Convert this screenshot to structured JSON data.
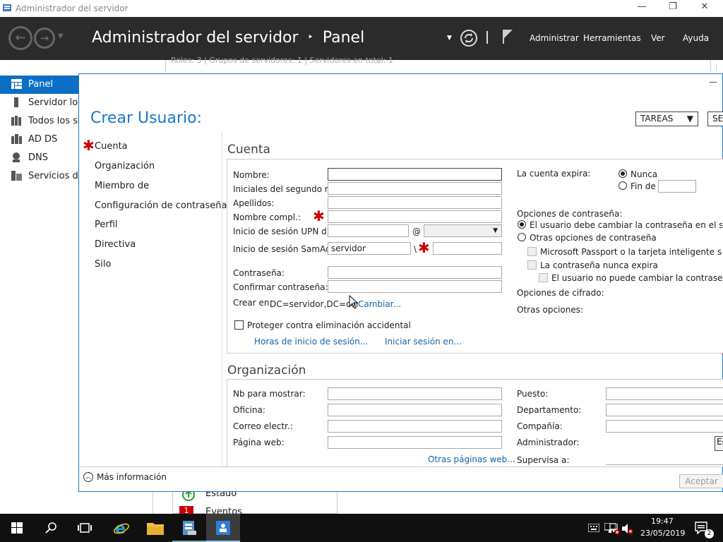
{
  "window": {
    "title": "Administrador del servidor"
  },
  "header": {
    "breadcrumb_root": "Administrador del servidor",
    "breadcrumb_sep": "‣",
    "breadcrumb_page": "Panel",
    "menu": [
      "Administrar",
      "Herramientas",
      "Ver",
      "Ayuda"
    ]
  },
  "sidebar": {
    "items": [
      {
        "label": "Panel",
        "icon": "dashboard-icon"
      },
      {
        "label": "Servidor local",
        "icon": "server-icon"
      },
      {
        "label": "Todos los servidores",
        "icon": "servers-icon"
      },
      {
        "label": "AD DS",
        "icon": "ad-ds-icon"
      },
      {
        "label": "DNS",
        "icon": "dns-icon"
      },
      {
        "label": "Servicios de archivos y de almacenamiento",
        "icon": "storage-icon"
      }
    ]
  },
  "background": {
    "strip": "Roles: 3  |  Grupos de servidores: 1  |  Servidores en total: 1",
    "status_label": "Estado",
    "events_label": "Eventos",
    "events_count": "1"
  },
  "dialog": {
    "title": "Crear Usuario:",
    "tasks_button": "TAREAS",
    "sections_button": "SECCIONES",
    "nav": [
      "Cuenta",
      "Organización",
      "Miembro de",
      "Configuración de contraseña",
      "Perfil",
      "Directiva",
      "Silo"
    ],
    "more_info": "Más información",
    "accept_button": "Aceptar"
  },
  "account": {
    "heading": "Cuenta",
    "first_name_label": "Nombre:",
    "initials_label": "Iniciales del segundo n...",
    "last_name_label": "Apellidos:",
    "full_name_label": "Nombre compl.:",
    "upn_label": "Inicio de sesión UPN d...",
    "upn_at": "@",
    "sam_label": "Inicio de sesión SamAc...",
    "sam_domain": "servidor",
    "sam_sep": "\\",
    "password_label": "Contraseña:",
    "confirm_label": "Confirmar contraseña:",
    "create_in_label": "Crear en:",
    "create_in_value": "DC=servidor,DC=com",
    "change_link": "Cambiar...",
    "protect_label": "Proteger contra eliminación accidental",
    "logon_hours_link": "Horas de inicio de sesión...",
    "logon_to_link": "Iniciar sesión en...",
    "expires_label": "La cuenta expira:",
    "never_label": "Nunca",
    "end_of_label": "Fin de",
    "password_options_label": "Opciones de contraseña:",
    "must_change_label": "El usuario debe cambiar la contraseña en el siguiente inicio de sesión",
    "other_options_label": "Otras opciones de contraseña",
    "passport_label": "Microsoft Passport o la tarjeta inteligente son necesarios",
    "never_expires_label": "La contraseña nunca expira",
    "cannot_change_label": "El usuario no puede cambiar la contraseña",
    "encryption_label": "Opciones de cifrado:",
    "other_label": "Otras opciones:"
  },
  "organization": {
    "heading": "Organización",
    "display_name_label": "Nb para mostrar:",
    "office_label": "Oficina:",
    "email_label": "Correo electr.:",
    "web_label": "Página web:",
    "other_web_link": "Otras páginas web...",
    "job_label": "Puesto:",
    "dept_label": "Departamento:",
    "company_label": "Compañía:",
    "manager_label": "Administrador:",
    "manager_edit": "Editar...",
    "reports_label": "Supervisa a:"
  },
  "taskbar": {
    "time": "19:47",
    "date": "23/05/2019",
    "notification_count": "2"
  },
  "colors": {
    "accent": "#1979ca",
    "header_bg": "#2b2b2b",
    "required": "#cc0000",
    "active_nav": "#0b6fc6"
  }
}
